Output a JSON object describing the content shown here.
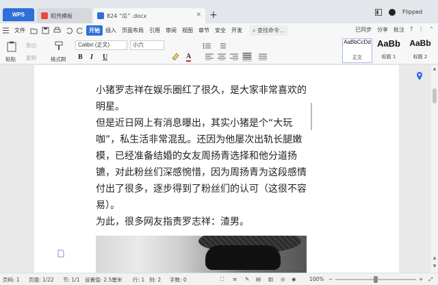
{
  "window": {
    "app_tab": "WPS",
    "tabs": [
      {
        "label": "稻壳模板",
        "active": false
      },
      {
        "label": "824 “瓜” .docx",
        "active": true
      }
    ],
    "user": "Flipped"
  },
  "menu": {
    "file": "文件",
    "items": [
      "开始",
      "插入",
      "页面布局",
      "引用",
      "审阅",
      "视图",
      "章节",
      "安全",
      "开发"
    ],
    "search": "查找命令...",
    "right": [
      "已同步",
      "分享",
      "批注"
    ]
  },
  "ribbon": {
    "paste": "粘贴",
    "cut": "剪切",
    "copy": "复制",
    "format_painter": "格式刷",
    "font_name": "Calibri (正文)",
    "font_size": "小六",
    "format_buttons": [
      "B",
      "I",
      "U",
      "A"
    ],
    "styles": [
      {
        "sample": "AaBbCcDd",
        "label": "正文"
      },
      {
        "sample": "AaBb",
        "label": "标题 1"
      },
      {
        "sample": "AaBb",
        "label": "标题 2"
      }
    ]
  },
  "document": {
    "paragraphs": [
      "小猪罗志祥在娱乐圈红了很久，是大家非常喜欢的明星。",
      "但是近日网上有消息曝出，其实小猪是个“大玩咖”，私生活非常混乱。还因为他屡次出轨长腿嫩模，已经准备结婚的女友周扬青选择和他分道扬镳，对此粉丝们深感惋惜，因为周扬青为这段感情付出了很多，逐步得到了粉丝们的认可（这很不容易）。",
      "为此，很多网友指责罗志祥：渣男。"
    ]
  },
  "status": {
    "page": "页码: 1",
    "pages": "页面: 1/22",
    "section": "节: 1/1",
    "setting": "设置值: 2.5厘米",
    "row": "行: 1",
    "col": "列: 2",
    "words": "字数: 0",
    "zoom": "100%",
    "zoom_level": 1.0
  },
  "colors": {
    "accent": "#2f6fda"
  }
}
